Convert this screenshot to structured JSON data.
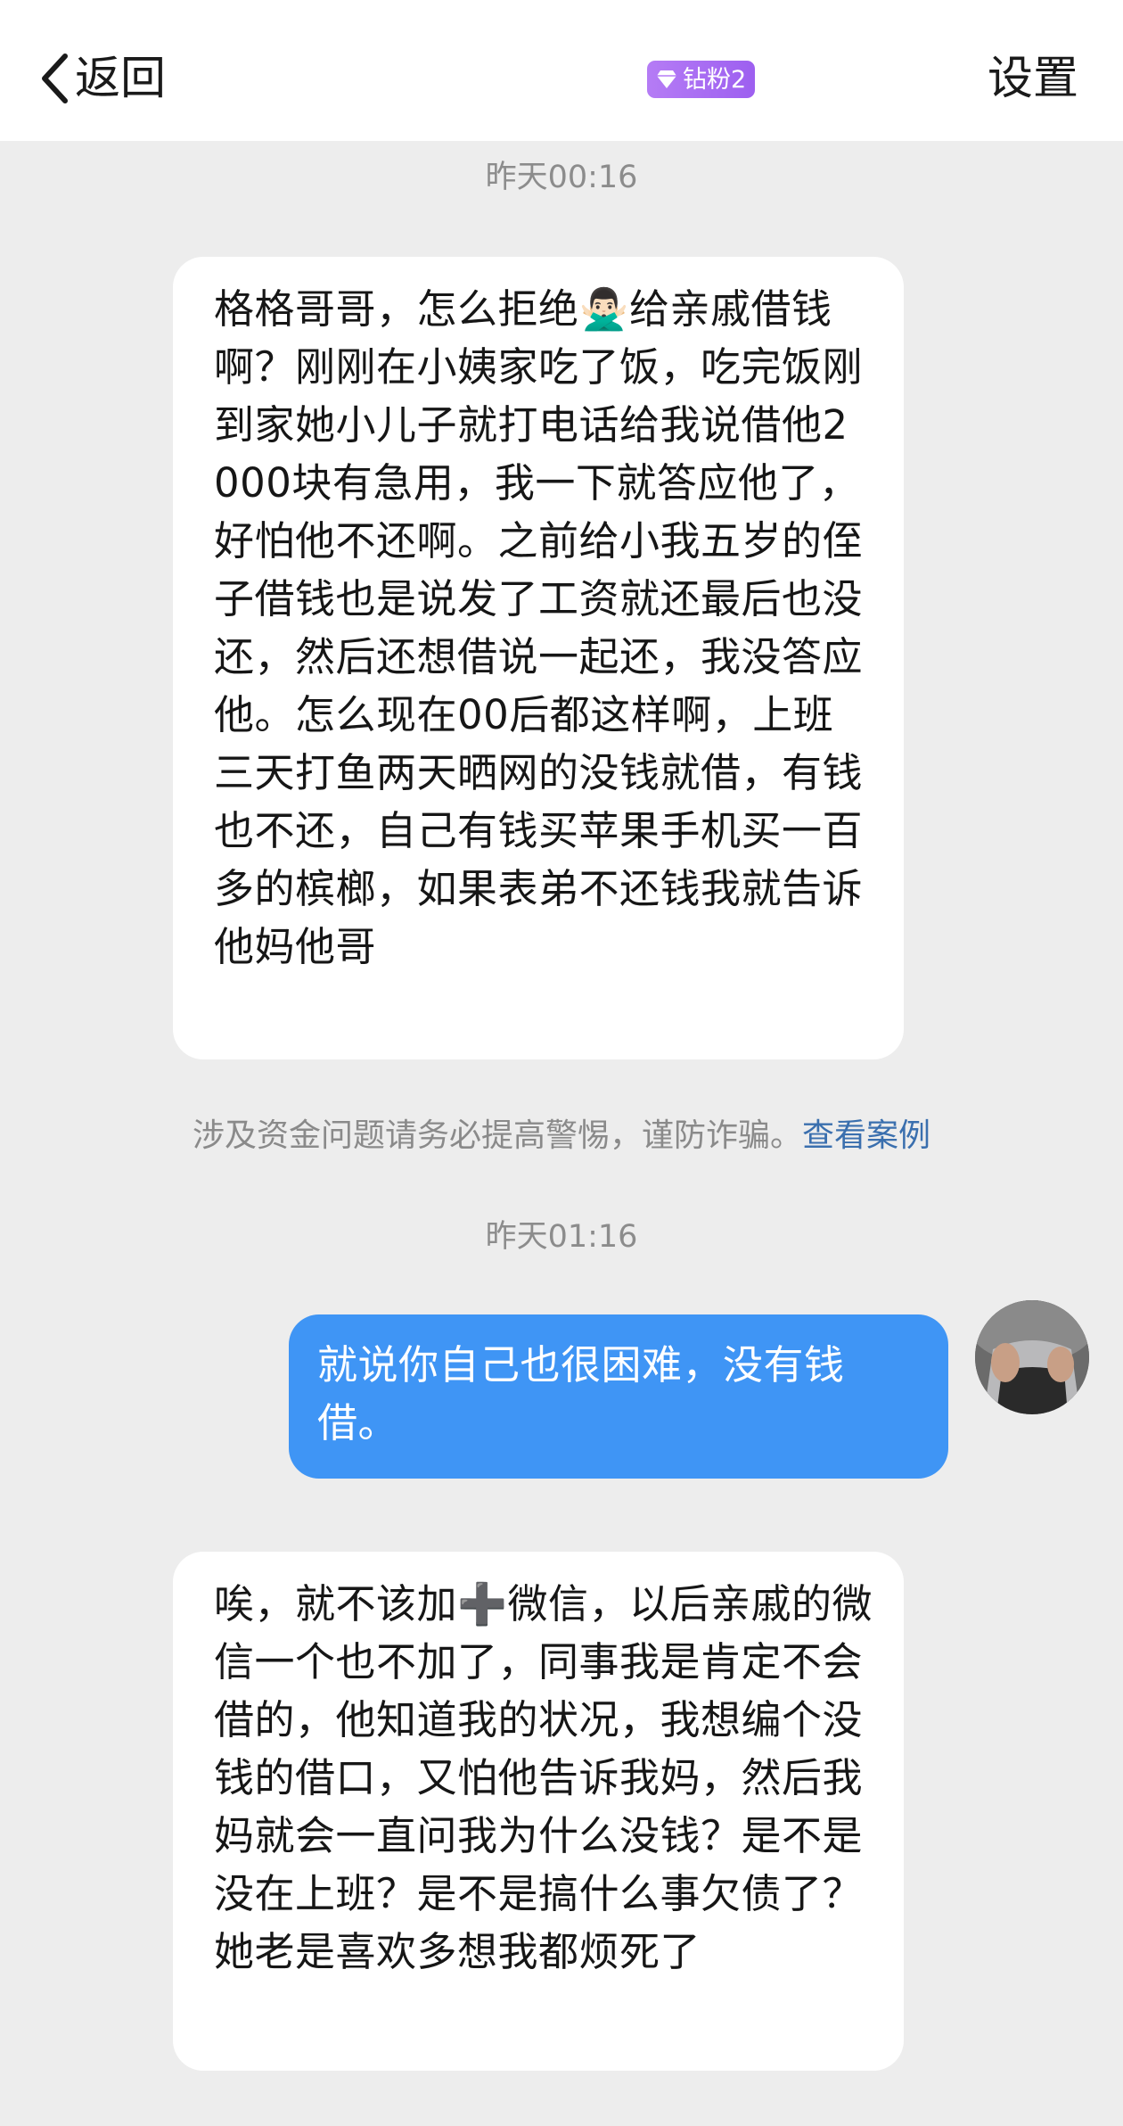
{
  "header": {
    "back_label": "返回",
    "badge_label": "钻粉2",
    "settings_label": "设置"
  },
  "messages": [
    {
      "timestamp": "昨天00:16",
      "direction": "incoming",
      "text": "格格哥哥，怎么拒绝🙅🏻‍♂️给亲戚借钱啊？刚刚在小姨家吃了饭，吃完饭刚到家她小儿子就打电话给我说借他2000块有急用，我一下就答应他了，好怕他不还啊。之前给小我五岁的侄子借钱也是说发了工资就还最后也没还，然后还想借说一起还，我没答应他。怎么现在00后都这样啊，上班三天打鱼两天晒网的没钱就借，有钱也不还，自己有钱买苹果手机买一百多的槟榔，如果表弟不还钱我就告诉他妈他哥"
    },
    {
      "timestamp": "昨天01:16",
      "direction": "outgoing",
      "text": "就说你自己也很困难，没有钱借。"
    },
    {
      "direction": "incoming",
      "text": "唉，就不该加➕微信，以后亲戚的微信一个也不加了，同事我是肯定不会借的，他知道我的状况，我想编个没钱的借口，又怕他告诉我妈，然后我妈就会一直问我为什么没钱？是不是没在上班？是不是搞什么事欠债了？她老是喜欢多想我都烦死了"
    }
  ],
  "warning": {
    "text": "涉及资金问题请务必提高警惕，谨防诈骗。",
    "link": "查看案例"
  },
  "colors": {
    "background": "#ededed",
    "outgoing_bubble": "#3f95f5",
    "incoming_bubble": "#ffffff",
    "link": "#3a6fae",
    "badge": "#a96cf3"
  },
  "icons": {
    "back": "chevron-left-icon",
    "badge": "diamond-icon"
  }
}
